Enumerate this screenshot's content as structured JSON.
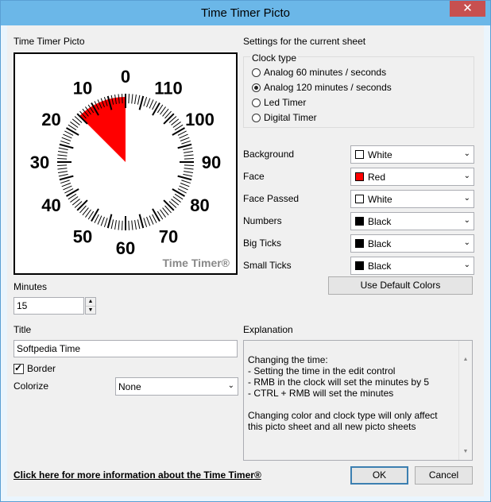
{
  "window": {
    "title": "Time Timer Picto",
    "close_glyph": "✕"
  },
  "preview": {
    "label": "Time Timer Picto",
    "minutes_set": 15,
    "scale_max": 120,
    "numbers": [
      "0",
      "10",
      "20",
      "30",
      "40",
      "50",
      "60",
      "70",
      "80",
      "90",
      "100",
      "110"
    ],
    "brand": "Time Timer®",
    "face_color": "#ff0000",
    "number_color": "#000000",
    "tick_color": "#000000"
  },
  "minutes": {
    "label": "Minutes",
    "value": "15"
  },
  "title_field": {
    "label": "Title",
    "value": "Softpedia Time"
  },
  "border": {
    "label": "Border",
    "checked": true
  },
  "colorize": {
    "label": "Colorize",
    "value": "None"
  },
  "settings": {
    "heading": "Settings for  the current sheet",
    "clock_type": {
      "label": "Clock type",
      "options": [
        {
          "label": "Analog 60 minutes / seconds",
          "checked": false
        },
        {
          "label": "Analog 120 minutes / seconds",
          "checked": true
        },
        {
          "label": "Led Timer",
          "checked": false
        },
        {
          "label": "Digital Timer",
          "checked": false
        }
      ]
    },
    "colors": [
      {
        "label": "Background",
        "value": "White",
        "swatch": "#ffffff"
      },
      {
        "label": "Face",
        "value": "Red",
        "swatch": "#ff0000"
      },
      {
        "label": "Face Passed",
        "value": "White",
        "swatch": "#ffffff"
      },
      {
        "label": "Numbers",
        "value": "Black",
        "swatch": "#000000"
      },
      {
        "label": "Big Ticks",
        "value": "Black",
        "swatch": "#000000"
      },
      {
        "label": "Small Ticks",
        "value": "Black",
        "swatch": "#000000"
      }
    ],
    "default_colors_button": "Use Default Colors"
  },
  "explanation": {
    "label": "Explanation",
    "text": "Changing the time:\n- Setting the time in the edit control\n- RMB in the clock will set the minutes by 5\n- CTRL + RMB will set the minutes\n\nChanging color and clock type will only affect\nthis picto sheet and all new picto sheets"
  },
  "footer": {
    "link": "Click here for more information about the Time Timer®",
    "ok": "OK",
    "cancel": "Cancel"
  }
}
